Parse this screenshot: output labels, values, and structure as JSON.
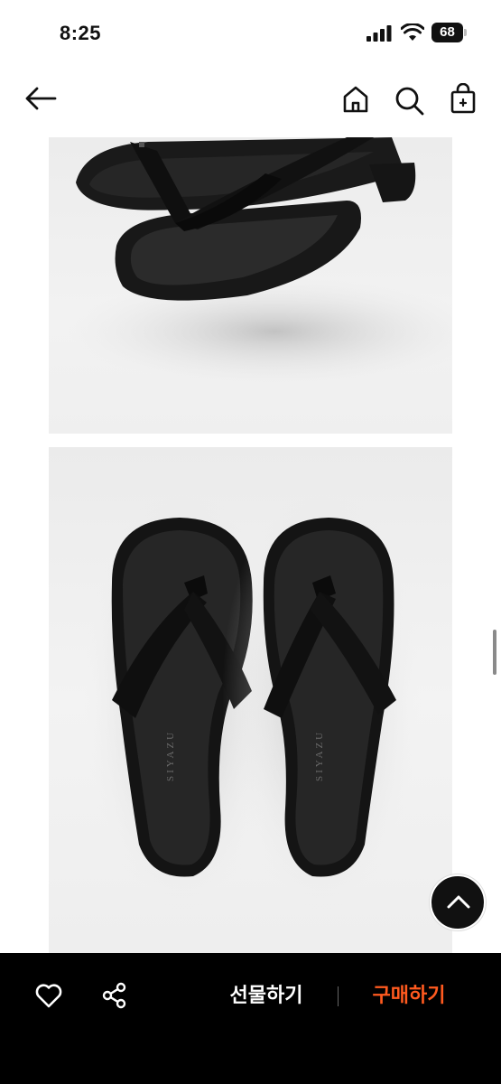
{
  "status_bar": {
    "time": "8:25",
    "battery_level": "68"
  },
  "nav": {
    "icons": [
      "back-arrow-icon",
      "home-icon",
      "search-icon",
      "shopping-bag-icon"
    ]
  },
  "product": {
    "brand_imprint": "SIYAZU",
    "images": [
      "product-photo-side-view",
      "product-photo-top-view"
    ]
  },
  "actions": {
    "gift_label": "선물하기",
    "buy_label": "구매하기"
  },
  "colors": {
    "accent": "#ff5a1f",
    "bottom_bar": "#000000"
  }
}
